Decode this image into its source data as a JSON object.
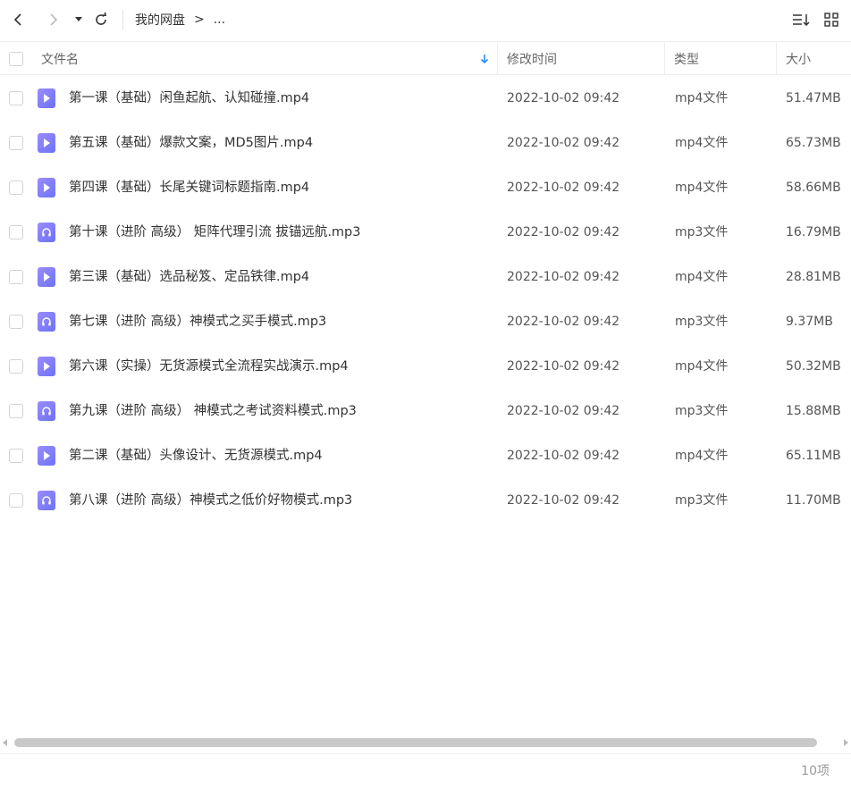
{
  "toolbar": {
    "breadcrumb": [
      "我的网盘",
      ">",
      "..."
    ]
  },
  "columns": {
    "name": "文件名",
    "time": "修改时间",
    "type": "类型",
    "size": "大小"
  },
  "files": [
    {
      "name": "第一课（基础）闲鱼起航、认知碰撞.mp4",
      "time": "2022-10-02 09:42",
      "type": "mp4文件",
      "size": "51.47MB",
      "kind": "mp4"
    },
    {
      "name": "第五课（基础）爆款文案，MD5图片.mp4",
      "time": "2022-10-02 09:42",
      "type": "mp4文件",
      "size": "65.73MB",
      "kind": "mp4"
    },
    {
      "name": "第四课（基础）长尾关键词标题指南.mp4",
      "time": "2022-10-02 09:42",
      "type": "mp4文件",
      "size": "58.66MB",
      "kind": "mp4"
    },
    {
      "name": "第十课（进阶 高级） 矩阵代理引流 拔锚远航.mp3",
      "time": "2022-10-02 09:42",
      "type": "mp3文件",
      "size": "16.79MB",
      "kind": "mp3"
    },
    {
      "name": "第三课（基础）选品秘笈、定品铁律.mp4",
      "time": "2022-10-02 09:42",
      "type": "mp4文件",
      "size": "28.81MB",
      "kind": "mp4"
    },
    {
      "name": "第七课（进阶 高级）神模式之买手模式.mp3",
      "time": "2022-10-02 09:42",
      "type": "mp3文件",
      "size": "9.37MB",
      "kind": "mp3"
    },
    {
      "name": "第六课（实操）无货源模式全流程实战演示.mp4",
      "time": "2022-10-02 09:42",
      "type": "mp4文件",
      "size": "50.32MB",
      "kind": "mp4"
    },
    {
      "name": "第九课（进阶 高级） 神模式之考试资料模式.mp3",
      "time": "2022-10-02 09:42",
      "type": "mp3文件",
      "size": "15.88MB",
      "kind": "mp3"
    },
    {
      "name": "第二课（基础）头像设计、无货源模式.mp4",
      "time": "2022-10-02 09:42",
      "type": "mp4文件",
      "size": "65.11MB",
      "kind": "mp4"
    },
    {
      "name": "第八课（进阶 高级）神模式之低价好物模式.mp3",
      "time": "2022-10-02 09:42",
      "type": "mp3文件",
      "size": "11.70MB",
      "kind": "mp3"
    }
  ],
  "footer": {
    "count": "10项"
  },
  "colors": {
    "accent": "#2b8ff7",
    "file_icon": "#7b7ff7"
  }
}
